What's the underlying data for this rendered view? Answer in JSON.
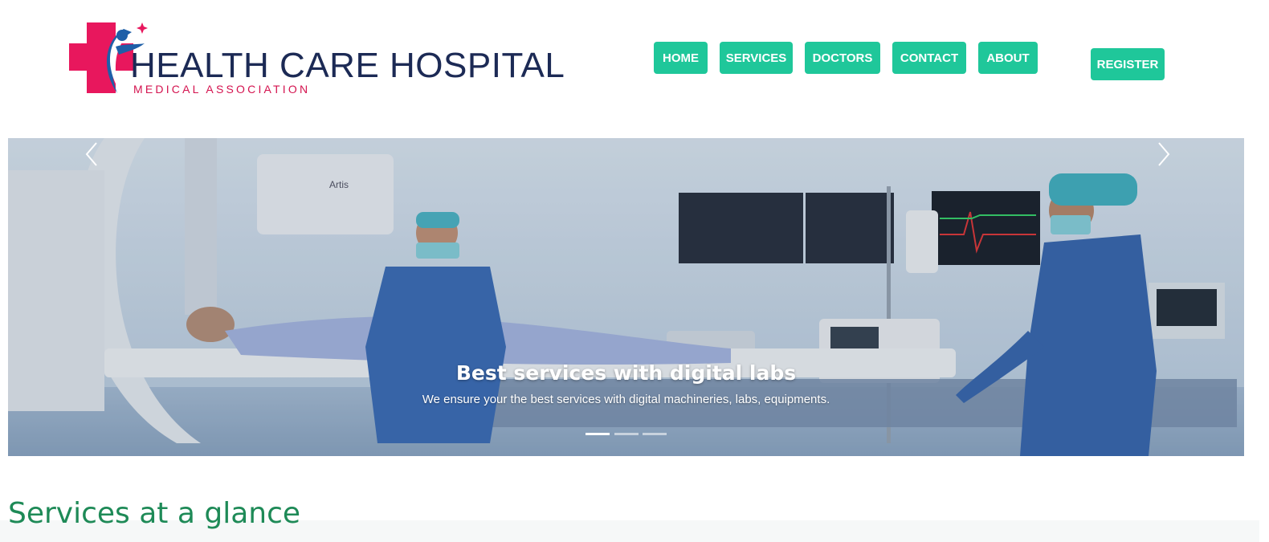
{
  "brand": {
    "name": "HEALTH CARE HOSPITAL",
    "tagline": "MEDICAL ASSOCIATION",
    "colors": {
      "primary": "#1c2a55",
      "accent": "#d4134f",
      "cross": "#e8175d",
      "figure": "#1e5fa8"
    }
  },
  "nav": {
    "items": [
      {
        "label": "HOME"
      },
      {
        "label": "SERVICES"
      },
      {
        "label": "DOCTORS"
      },
      {
        "label": "CONTACT"
      },
      {
        "label": "ABOUT"
      }
    ],
    "register_label": "REGISTER",
    "button_color": "#1fc79a"
  },
  "carousel": {
    "slide": {
      "title": "Best services with digital labs",
      "subtitle": "We ensure your the best services with digital machineries, labs, equipments.",
      "image": "hospital-operating-room-photo"
    },
    "slide_count": 3,
    "active_index": 0,
    "prev_icon": "chevron-left-icon",
    "next_icon": "chevron-right-icon"
  },
  "section": {
    "title": "Services at a glance",
    "title_color": "#1e8a57"
  }
}
